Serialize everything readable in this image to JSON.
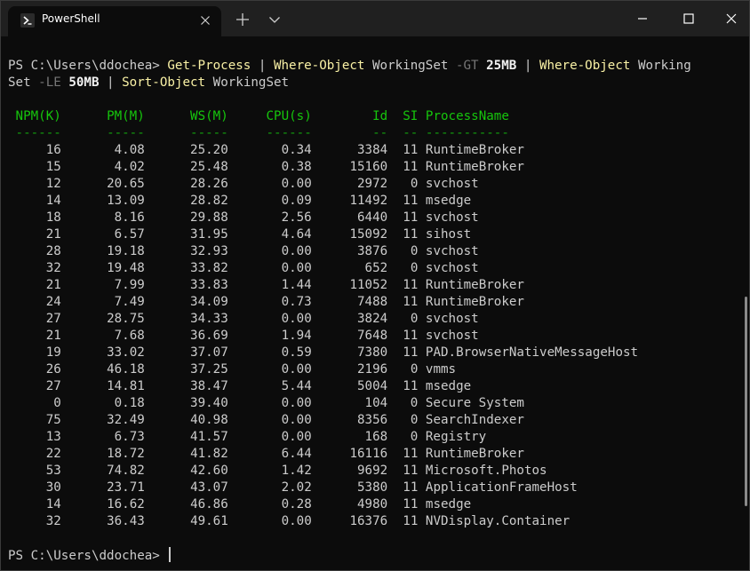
{
  "window": {
    "tab_title": "PowerShell",
    "tab_icon": "powershell-icon",
    "new_tab_icon": "plus-icon",
    "dropdown_icon": "chevron-down-icon",
    "minimize_icon": "minimize-icon",
    "maximize_icon": "maximize-icon",
    "close_icon": "close-icon"
  },
  "terminal": {
    "prompt": "PS C:\\Users\\ddochea>",
    "command": {
      "line1": [
        {
          "t": "PS C:\\Users\\ddochea> ",
          "c": "arg"
        },
        {
          "t": "Get-Process",
          "c": "cmd"
        },
        {
          "t": " | ",
          "c": "op"
        },
        {
          "t": "Where-Object",
          "c": "cmd"
        },
        {
          "t": " WorkingSet ",
          "c": "arg"
        },
        {
          "t": "-GT",
          "c": "param"
        },
        {
          "t": " ",
          "c": "arg"
        },
        {
          "t": "25MB",
          "c": "num"
        },
        {
          "t": " | ",
          "c": "op"
        },
        {
          "t": "Where-Object",
          "c": "cmd"
        },
        {
          "t": " Working",
          "c": "arg"
        }
      ],
      "line2": [
        {
          "t": "Set ",
          "c": "arg"
        },
        {
          "t": "-LE",
          "c": "param"
        },
        {
          "t": " ",
          "c": "arg"
        },
        {
          "t": "50MB",
          "c": "num"
        },
        {
          "t": " | ",
          "c": "op"
        },
        {
          "t": "Sort-Object",
          "c": "cmd"
        },
        {
          "t": " WorkingSet",
          "c": "arg"
        }
      ]
    },
    "headers": [
      "NPM(K)",
      "PM(M)",
      "WS(M)",
      "CPU(s)",
      "Id",
      "SI",
      "ProcessName"
    ],
    "separators": [
      "------",
      "-----",
      "-----",
      "------",
      "--",
      "--",
      "-----------"
    ],
    "rows": [
      [
        "16",
        "4.08",
        "25.20",
        "0.34",
        "3384",
        "11",
        "RuntimeBroker"
      ],
      [
        "15",
        "4.02",
        "25.48",
        "0.38",
        "15160",
        "11",
        "RuntimeBroker"
      ],
      [
        "12",
        "20.65",
        "28.26",
        "0.00",
        "2972",
        "0",
        "svchost"
      ],
      [
        "14",
        "13.09",
        "28.82",
        "0.09",
        "11492",
        "11",
        "msedge"
      ],
      [
        "18",
        "8.16",
        "29.88",
        "2.56",
        "6440",
        "11",
        "svchost"
      ],
      [
        "21",
        "6.57",
        "31.95",
        "4.64",
        "15092",
        "11",
        "sihost"
      ],
      [
        "28",
        "19.18",
        "32.93",
        "0.00",
        "3876",
        "0",
        "svchost"
      ],
      [
        "32",
        "19.48",
        "33.82",
        "0.00",
        "652",
        "0",
        "svchost"
      ],
      [
        "21",
        "7.99",
        "33.83",
        "1.44",
        "11052",
        "11",
        "RuntimeBroker"
      ],
      [
        "24",
        "7.49",
        "34.09",
        "0.73",
        "7488",
        "11",
        "RuntimeBroker"
      ],
      [
        "27",
        "28.75",
        "34.33",
        "0.00",
        "3824",
        "0",
        "svchost"
      ],
      [
        "21",
        "7.68",
        "36.69",
        "1.94",
        "7648",
        "11",
        "svchost"
      ],
      [
        "19",
        "33.02",
        "37.07",
        "0.59",
        "7380",
        "11",
        "PAD.BrowserNativeMessageHost"
      ],
      [
        "26",
        "46.18",
        "37.25",
        "0.00",
        "2196",
        "0",
        "vmms"
      ],
      [
        "27",
        "14.81",
        "38.47",
        "5.44",
        "5004",
        "11",
        "msedge"
      ],
      [
        "0",
        "0.18",
        "39.40",
        "0.00",
        "104",
        "0",
        "Secure System"
      ],
      [
        "75",
        "32.49",
        "40.98",
        "0.00",
        "8356",
        "0",
        "SearchIndexer"
      ],
      [
        "13",
        "6.73",
        "41.57",
        "0.00",
        "168",
        "0",
        "Registry"
      ],
      [
        "22",
        "18.72",
        "41.82",
        "6.44",
        "16116",
        "11",
        "RuntimeBroker"
      ],
      [
        "53",
        "74.82",
        "42.60",
        "1.42",
        "9692",
        "11",
        "Microsoft.Photos"
      ],
      [
        "30",
        "23.71",
        "43.07",
        "2.02",
        "5380",
        "11",
        "ApplicationFrameHost"
      ],
      [
        "14",
        "16.62",
        "46.86",
        "0.28",
        "4980",
        "11",
        "msedge"
      ],
      [
        "32",
        "36.43",
        "49.61",
        "0.00",
        "16376",
        "11",
        "NVDisplay.Container"
      ]
    ],
    "final_prompt": "PS C:\\Users\\ddochea> "
  }
}
